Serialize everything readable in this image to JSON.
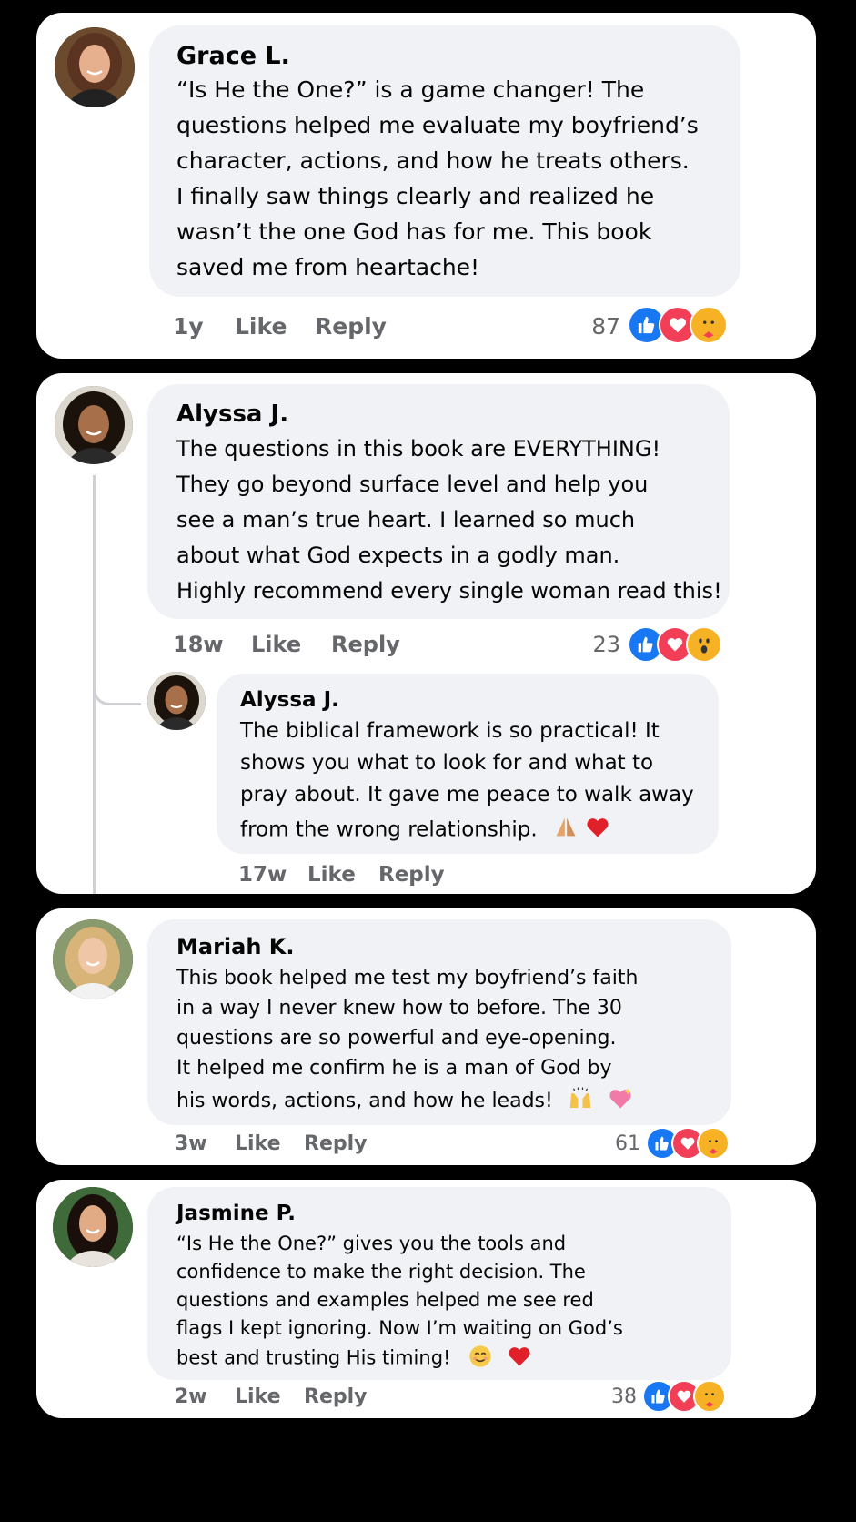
{
  "comments": [
    {
      "name": "Grace L.",
      "lines": [
        "“Is He the One?” is a game changer! The",
        "questions helped me evaluate my boyfriend’s",
        "character, actions, and how he treats others.",
        "I finally saw things clearly and realized he",
        "wasn’t the one God has for me. This book",
        "saved me from heartache!"
      ],
      "time": "1y",
      "like_label": "Like",
      "reply_label": "Reply",
      "reaction_count": "87",
      "reactions": [
        "like-icon",
        "love-icon",
        "care-icon"
      ],
      "hair": "#5a3420"
    },
    {
      "name": "Alyssa J.",
      "lines": [
        "The questions in this book are EVERYTHING!",
        "They go beyond surface level and help you",
        "see a man’s true heart. I learned so much",
        "about what God expects in a godly man.",
        "Highly recommend every single woman read this!"
      ],
      "time": "18w",
      "like_label": "Like",
      "reply_label": "Reply",
      "reaction_count": "23",
      "reactions": [
        "like-icon",
        "love-icon",
        "wow-icon"
      ],
      "hair": "#1c120c",
      "reply": {
        "name": "Alyssa J.",
        "lines": [
          "The biblical framework is so practical! It",
          "shows you what to look for and what to",
          "pray about. It gave me peace to walk away",
          "from the wrong relationship."
        ],
        "emoji": [
          "folded-hands-icon",
          "red-heart-icon"
        ],
        "time": "17w",
        "like_label": "Like",
        "reply_label": "Reply"
      }
    },
    {
      "name": "Mariah K.",
      "lines": [
        "This book helped me test my boyfriend’s faith",
        "in a way I never knew how to before. The 30",
        "questions are so powerful and eye-opening.",
        "It helped me confirm he is a man of God by",
        "his words, actions, and how he leads!"
      ],
      "emoji": [
        "raising-hands-icon",
        "sparkling-heart-icon"
      ],
      "time": "3w",
      "like_label": "Like",
      "reply_label": "Reply",
      "reaction_count": "61",
      "reactions": [
        "like-icon",
        "love-icon",
        "care-icon"
      ],
      "hair": "#d8b478"
    },
    {
      "name": "Jasmine P.",
      "lines": [
        "“Is He the One?” gives you the tools and",
        "confidence to make the right decision. The",
        "questions and examples helped me see red",
        "flags I kept ignoring. Now I’m waiting on God’s",
        "best and trusting His timing!"
      ],
      "emoji": [
        "smiling-face-icon",
        "red-heart-icon"
      ],
      "time": "2w",
      "like_label": "Like",
      "reply_label": "Reply",
      "reaction_count": "38",
      "reactions": [
        "like-icon",
        "love-icon",
        "care-icon"
      ],
      "hair": "#1a0f0a"
    }
  ],
  "colors": {
    "like": "#1877f2",
    "love": "#f33e58",
    "yellow": "#f7b125",
    "meta": "#65676b",
    "bubble": "#f0f2f5"
  }
}
